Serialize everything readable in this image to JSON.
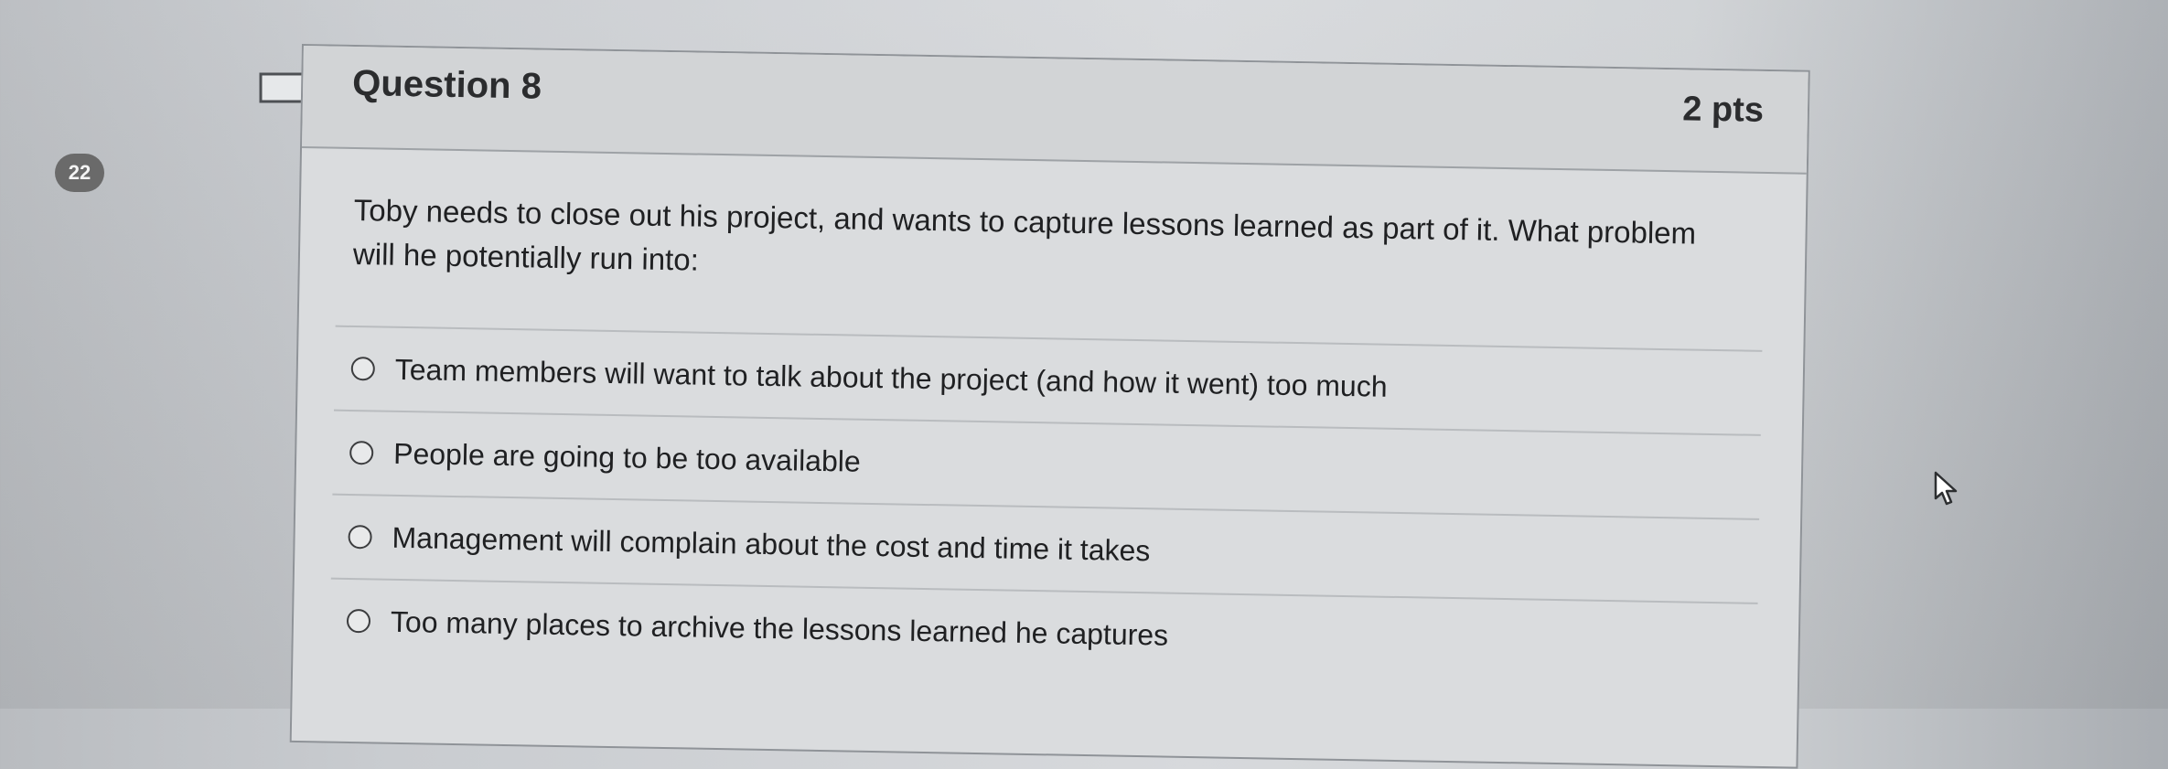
{
  "question": {
    "badge_number": "22",
    "title": "Question 8",
    "points": "2 pts",
    "prompt": "Toby needs to close out his project, and wants to capture lessons learned as part of it.  What problem will he potentially run into:",
    "answers": [
      "Team members will want to talk about the project (and how it went) too much",
      "People are going to be too available",
      "Management will complain about the cost and time it takes",
      "Too many places to archive the lessons learned he captures"
    ]
  },
  "icons": {
    "flag": "flag-icon",
    "cursor": "mouse-pointer-icon"
  }
}
